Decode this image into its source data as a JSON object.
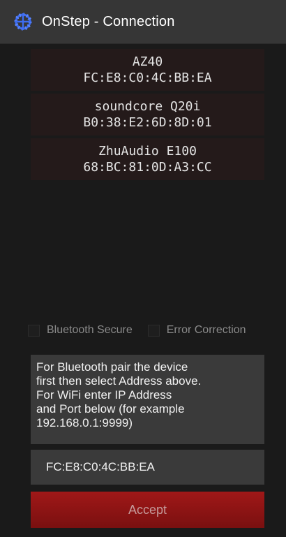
{
  "header": {
    "title": "OnStep - Connection",
    "icon": "crosshair-gear-icon",
    "icon_color": "#3d6cf0"
  },
  "devices": [
    {
      "name": "AZ40",
      "address": "FC:E8:C0:4C:BB:EA"
    },
    {
      "name": "soundcore Q20i",
      "address": "B0:38:E2:6D:8D:01"
    },
    {
      "name": "ZhuAudio E100",
      "address": "68:BC:81:0D:A3:CC"
    }
  ],
  "options": {
    "bluetooth_secure": {
      "label": "Bluetooth Secure",
      "checked": false
    },
    "error_correction": {
      "label": "Error Correction",
      "checked": false
    }
  },
  "help": {
    "lines": [
      "For Bluetooth pair the device",
      "first then select Address above.",
      "For WiFi enter IP Address",
      "and Port below (for example",
      "192.168.0.1:9999)"
    ]
  },
  "address_field": {
    "value": "FC:E8:C0:4C:BB:EA"
  },
  "accept": {
    "label": "Accept",
    "color": "#9a1414"
  }
}
